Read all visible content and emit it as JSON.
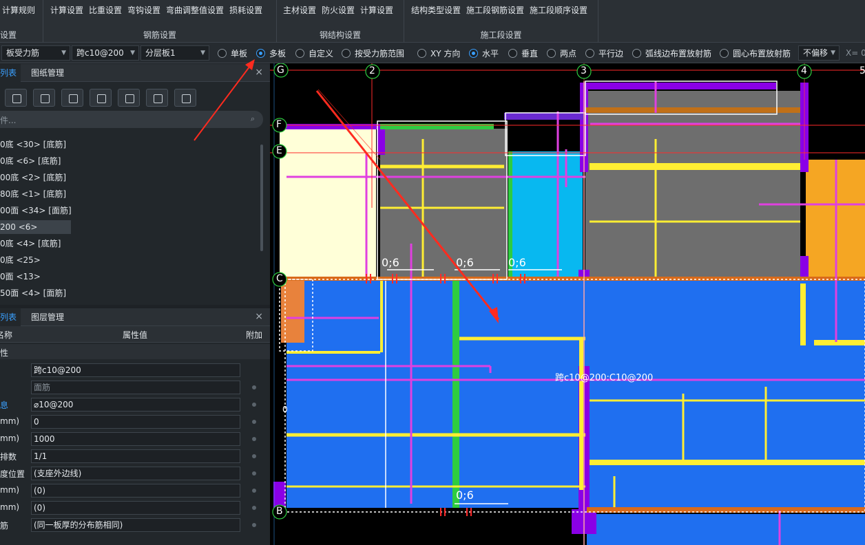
{
  "ribbon": {
    "groups": [
      {
        "items": [
          "计算规则"
        ],
        "title": "设置"
      },
      {
        "items": [
          "计算设置",
          "比重设置",
          "弯钩设置",
          "弯曲调整值设置",
          "损耗设置"
        ],
        "title": "钢筋设置"
      },
      {
        "items": [
          "主材设置",
          "防火设置",
          "计算设置"
        ],
        "title": "钢结构设置"
      },
      {
        "items": [
          "结构类型设置",
          "施工段钢筋设置",
          "施工段顺序设置"
        ],
        "title": "施工段设置"
      }
    ]
  },
  "toolbar": {
    "type_combo": "板受力筋",
    "spec_combo": "跨c10@200",
    "layer_combo": "分层板1",
    "radios": [
      {
        "label": "单板",
        "checked": false
      },
      {
        "label": "多板",
        "checked": true
      },
      {
        "label": "自定义",
        "checked": false
      },
      {
        "label": "按受力筋范围",
        "checked": false
      },
      {
        "label": "XY 方向",
        "checked": false
      },
      {
        "label": "水平",
        "checked": true
      },
      {
        "label": "垂直",
        "checked": false
      },
      {
        "label": "两点",
        "checked": false
      },
      {
        "label": "平行边",
        "checked": false
      },
      {
        "label": "弧线边布置放射筋",
        "checked": false
      },
      {
        "label": "圆心布置放射筋",
        "checked": false
      }
    ],
    "offset_combo": "不偏移",
    "x_label": "X= 0"
  },
  "component_panel": {
    "tab_list": "列表",
    "tab_drawing": "图纸管理",
    "close": "×",
    "search_placeholder": "件...",
    "items": [
      "0底 <30> [底筋]",
      "0底 <6> [底筋]",
      "00底 <2> [底筋]",
      "80底 <1> [底筋]",
      "00面 <34> [面筋]",
      "200 <6>",
      "0底 <4> [底筋]",
      "0底 <25>",
      "0面 <13>",
      "50面 <4> [面筋]"
    ],
    "selected_index": 5
  },
  "property_panel": {
    "tab_list": "列表",
    "tab_layer": "图层管理",
    "close": "×",
    "col_name": "名称",
    "col_value": "属性值",
    "col_extra": "附加",
    "section": "性",
    "rows": [
      {
        "key": "",
        "value": "跨c10@200",
        "gray": false,
        "blue": false
      },
      {
        "key": "",
        "value": "面筋",
        "gray": true,
        "blue": false
      },
      {
        "key": "息",
        "value": "⌀10@200",
        "gray": false,
        "blue": true
      },
      {
        "key": "mm)",
        "value": "0",
        "gray": false,
        "blue": false
      },
      {
        "key": "mm)",
        "value": "1000",
        "gray": false,
        "blue": false
      },
      {
        "key": "排数",
        "value": "1/1",
        "gray": false,
        "blue": false
      },
      {
        "key": "度位置",
        "value": "(支座外边线)",
        "gray": false,
        "blue": false
      },
      {
        "key": "mm)",
        "value": "(0)",
        "gray": false,
        "blue": false
      },
      {
        "key": "mm)",
        "value": "(0)",
        "gray": false,
        "blue": false
      },
      {
        "key": "筋",
        "value": "(同一板厚的分布筋相同)",
        "gray": false,
        "blue": false
      }
    ]
  },
  "canvas": {
    "axes_top": [
      "G",
      "2",
      "3",
      "4",
      "5"
    ],
    "axes_left": [
      "F",
      "E",
      "C",
      "B"
    ],
    "annotations": [
      "0;6",
      "0;6",
      "0;6",
      "0;6"
    ],
    "rebar_label": "跨c10@200:C10@200",
    "left_mark": "0",
    "colors": {
      "slab_blue": "#1f6ff0",
      "slab_gray": "#6e6e6e",
      "slab_cyan": "#08b8f0",
      "slab_cream": "#ffffd8",
      "slab_orange": "#f5a623",
      "rebar_yellow": "#ffee33",
      "rebar_magenta": "#e040e0",
      "beam_purple": "#8a00e6",
      "axis_red": "#ff2a2a",
      "arrow_red": "#ff2b1f"
    }
  }
}
